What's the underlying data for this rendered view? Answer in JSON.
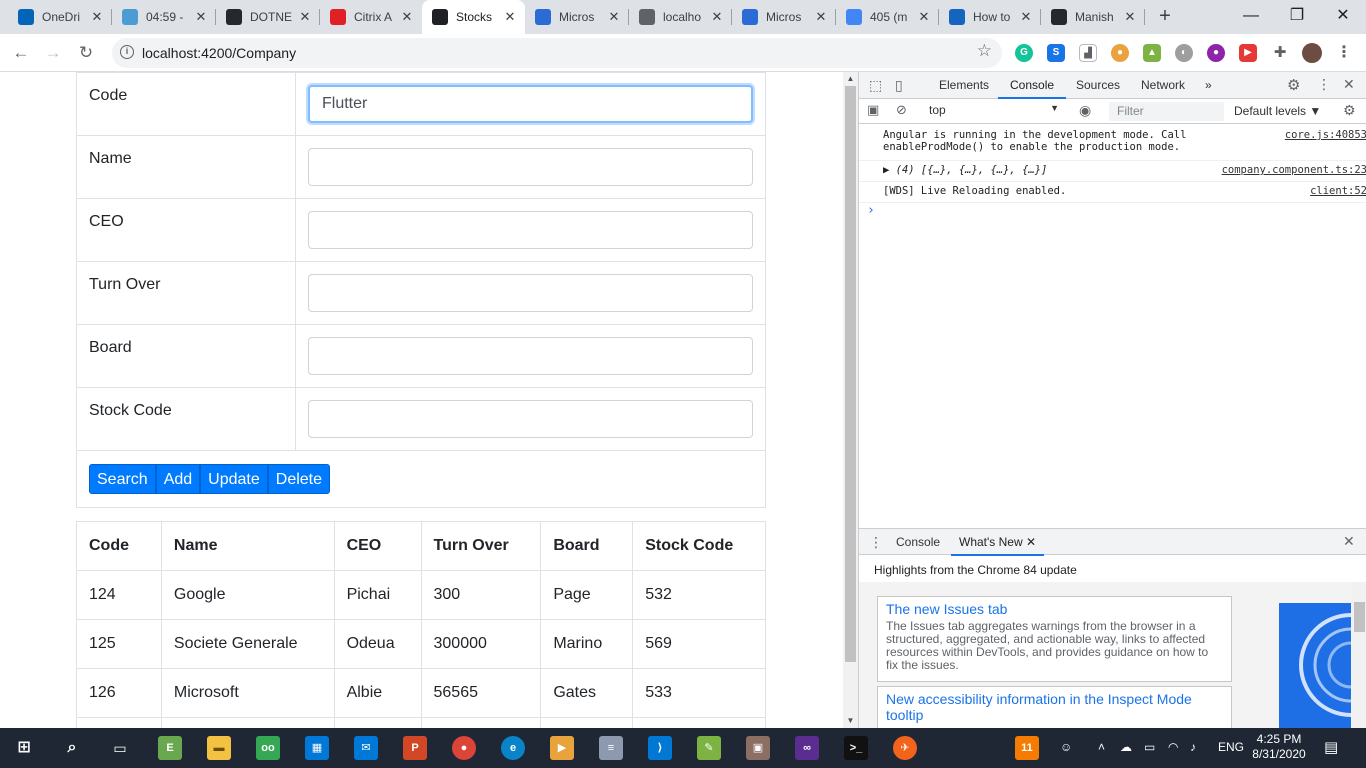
{
  "browser": {
    "tabs": [
      {
        "title": "OneDri",
        "icon": "onedrive-icon",
        "color": "#0364b8"
      },
      {
        "title": "04:59 -",
        "icon": "checkmark-icon",
        "color": "#4b9cd3"
      },
      {
        "title": "DOTNE",
        "icon": "github-icon",
        "color": "#24292e"
      },
      {
        "title": "Citrix A",
        "icon": "citrix-icon",
        "color": "#e01f26"
      },
      {
        "title": "Stocks",
        "icon": "angular-icon",
        "color": "#202124"
      },
      {
        "title": "Micros",
        "icon": "ms-learn-icon",
        "color": "#2b6bd6"
      },
      {
        "title": "localho",
        "icon": "globe-icon",
        "color": "#5f6368"
      },
      {
        "title": "Micros",
        "icon": "ms-learn-icon",
        "color": "#2b6bd6"
      },
      {
        "title": "405 (m",
        "icon": "google-icon",
        "color": "#4285f4"
      },
      {
        "title": "How to",
        "icon": "k-icon",
        "color": "#1565c0"
      },
      {
        "title": "Manish",
        "icon": "github-icon",
        "color": "#24292e"
      }
    ],
    "new_tab": "+",
    "window": {
      "minimize": "—",
      "maximize": "❐",
      "close": "✕"
    },
    "url": "localhost:4200/Company"
  },
  "form": {
    "fields": [
      {
        "label": "Code",
        "value": "Flutter"
      },
      {
        "label": "Name",
        "value": ""
      },
      {
        "label": "CEO",
        "value": ""
      },
      {
        "label": "Turn Over",
        "value": ""
      },
      {
        "label": "Board",
        "value": ""
      },
      {
        "label": "Stock Code",
        "value": ""
      }
    ],
    "buttons": {
      "search": "Search",
      "add": "Add",
      "update": "Update",
      "delete": "Delete"
    }
  },
  "table": {
    "headers": [
      "Code",
      "Name",
      "CEO",
      "Turn Over",
      "Board",
      "Stock Code"
    ],
    "rows": [
      [
        "124",
        "Google",
        "Pichai",
        "300",
        "Page",
        "532"
      ],
      [
        "125",
        "Societe Generale",
        "Odeua",
        "300000",
        "Marino",
        "569"
      ],
      [
        "126",
        "Microsoft",
        "Albie",
        "56565",
        "Gates",
        "533"
      ]
    ]
  },
  "devtools": {
    "tabs": [
      "Elements",
      "Console",
      "Sources",
      "Network",
      "»"
    ],
    "context": "top",
    "filter_placeholder": "Filter",
    "levels": "Default levels ▼",
    "logs": [
      {
        "msg": "Angular is running in the development mode. Call\nenableProdMode() to enable the production mode.",
        "src": "core.js:40853"
      },
      {
        "msg": "▶ (4) [{…}, {…}, {…}, {…}]",
        "src": "company.component.ts:23"
      },
      {
        "msg": "[WDS] Live Reloading enabled.",
        "src": "client:52"
      }
    ],
    "prompt": "›",
    "drawer": {
      "tabs": [
        "Console",
        "What's New"
      ],
      "highlights": "Highlights from the Chrome 84 update",
      "cards": [
        {
          "title": "The new Issues tab",
          "desc": "The Issues tab aggregates warnings from the browser in a structured, aggregated, and actionable way, links to affected resources within DevTools, and provides guidance on how to fix the issues."
        },
        {
          "title": "New accessibility information in the Inspect Mode tooltip",
          "desc": ""
        }
      ]
    }
  },
  "taskbar": {
    "lang": "ENG",
    "time": "4:25 PM",
    "date": "8/31/2020",
    "notification_count": "11"
  }
}
